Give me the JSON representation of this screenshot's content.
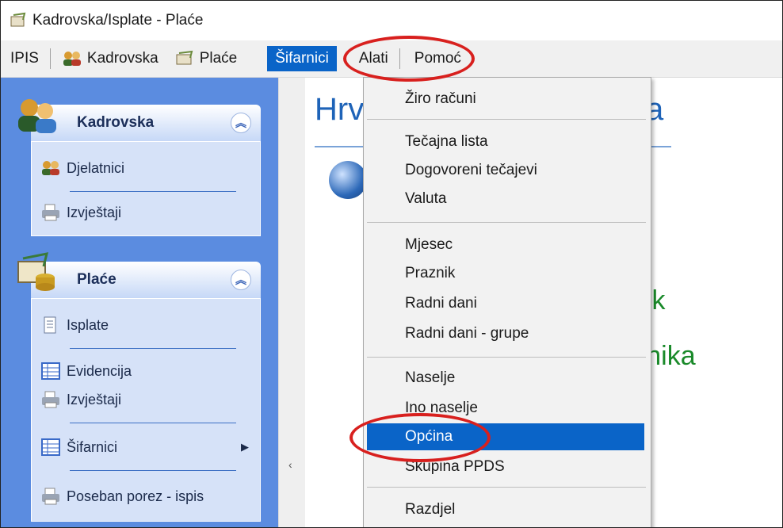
{
  "window": {
    "title": "Kadrovska/Isplate - Plaće"
  },
  "menubar": {
    "items": [
      {
        "label": "IPIS"
      },
      {
        "label": "Kadrovska"
      },
      {
        "label": "Plaće"
      },
      {
        "label": "Šifarnici"
      },
      {
        "label": "Alati"
      },
      {
        "label": "Pomoć"
      }
    ]
  },
  "sidebar": {
    "kadrovska": {
      "title": "Kadrovska",
      "items": [
        {
          "label": "Djelatnici"
        },
        {
          "label": "Izvještaji"
        }
      ]
    },
    "place": {
      "title": "Plaće",
      "items": [
        {
          "label": "Isplate"
        },
        {
          "label": "Evidencija"
        },
        {
          "label": "Izvještaji"
        },
        {
          "label": "Šifarnici"
        },
        {
          "label": "Poseban porez - ispis"
        }
      ]
    }
  },
  "main": {
    "title_start": "Hrv",
    "title_end": "a",
    "text_line1": "ik",
    "text_line2": "renika"
  },
  "dropdown": {
    "items": [
      {
        "label": "Žiro računi"
      },
      {
        "label": "Tečajna lista"
      },
      {
        "label": "Dogovoreni tečajevi"
      },
      {
        "label": "Valuta"
      },
      {
        "label": "Mjesec"
      },
      {
        "label": "Praznik"
      },
      {
        "label": "Radni dani"
      },
      {
        "label": "Radni dani - grupe"
      },
      {
        "label": "Naselje"
      },
      {
        "label": "Ino naselje"
      },
      {
        "label": "Općina"
      },
      {
        "label": "Skupina PPDS"
      },
      {
        "label": "Razdjel"
      }
    ],
    "highlighted": "Općina"
  },
  "colors": {
    "highlight": "#0a64c8",
    "annotation": "#d8201e",
    "sidebar": "#5b8ce0"
  }
}
